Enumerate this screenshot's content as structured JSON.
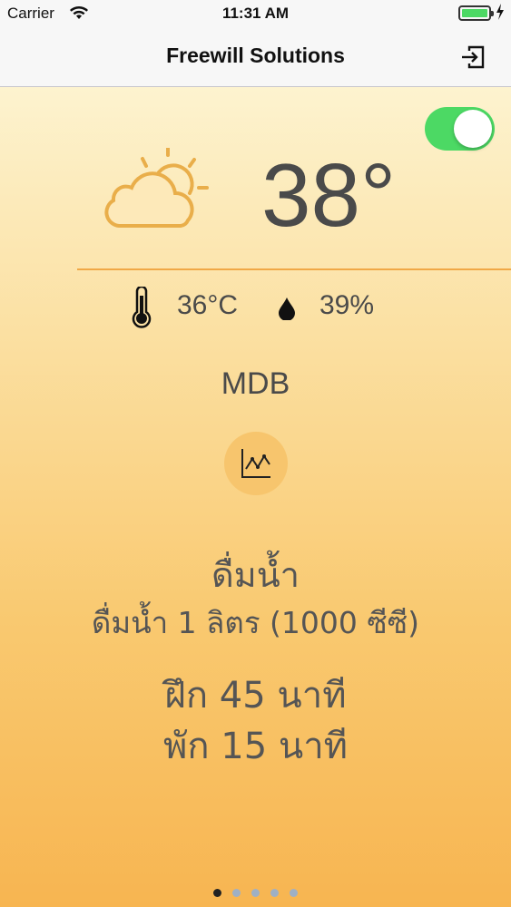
{
  "status_bar": {
    "carrier": "Carrier",
    "time": "11:31 AM",
    "battery_level": 1.0
  },
  "nav": {
    "title": "Freewill Solutions",
    "logout_icon": "logout-icon"
  },
  "weather": {
    "toggle_on": true,
    "icon": "partly-cloudy-icon",
    "temperature": "38°",
    "temp_celsius": "36°C",
    "humidity": "39%",
    "location": "MDB",
    "chart_icon": "line-chart-icon"
  },
  "advice": {
    "drink_title": "ดื่มน้ำ",
    "drink_detail": "ดื่มน้ำ 1 ลิตร (1000 ซีซี)",
    "train": "ฝึก 45 นาที",
    "rest": "พัก 15 นาที"
  },
  "pager": {
    "count": 5,
    "active_index": 0
  },
  "colors": {
    "toggle_on": "#4cd964",
    "accent": "#f0a846",
    "icon": "#e9ae4a",
    "text": "#4a4a4a"
  }
}
